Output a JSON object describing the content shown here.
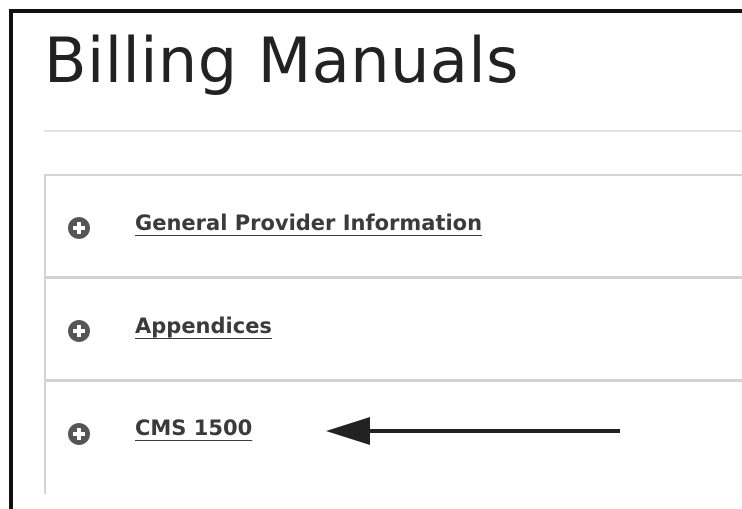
{
  "page": {
    "title": "Billing Manuals"
  },
  "accordion": {
    "items": [
      {
        "label": "General Provider Information",
        "icon": "plus-circle-icon"
      },
      {
        "label": "Appendices",
        "icon": "plus-circle-icon"
      },
      {
        "label": "CMS 1500",
        "icon": "plus-circle-icon"
      }
    ]
  },
  "annotation": {
    "arrow_color": "#222222",
    "points_to": "CMS 1500"
  },
  "colors": {
    "text": "#222222",
    "link": "#3b3b3b",
    "icon": "#555555",
    "divider": "#d2d2d2"
  }
}
